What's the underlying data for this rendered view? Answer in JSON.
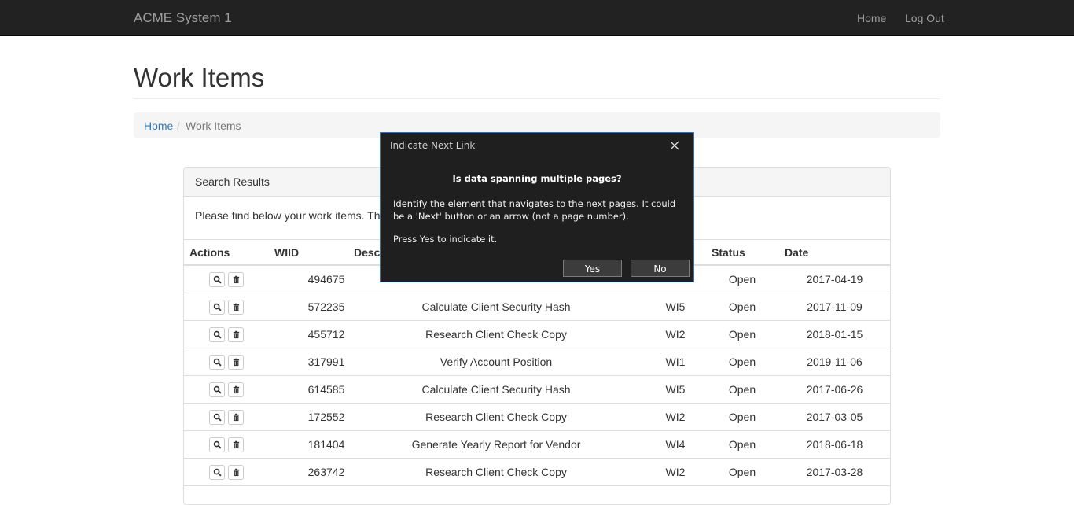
{
  "navbar": {
    "brand": "ACME System 1",
    "links": [
      "Home",
      "Log Out"
    ]
  },
  "page": {
    "title": "Work Items"
  },
  "breadcrumb": {
    "home": "Home",
    "separator": "/",
    "current": "Work Items"
  },
  "panel": {
    "title": "Search Results",
    "text": "Please find below your work items. They n",
    "columns": [
      "Actions",
      "WIID",
      "Descr",
      "Status",
      "Date"
    ],
    "rows": [
      {
        "wiid": "494675",
        "description": "",
        "type": "",
        "status": "Open",
        "date": "2017-04-19"
      },
      {
        "wiid": "572235",
        "description": "Calculate Client Security Hash",
        "type": "WI5",
        "status": "Open",
        "date": "2017-11-09"
      },
      {
        "wiid": "455712",
        "description": "Research Client Check Copy",
        "type": "WI2",
        "status": "Open",
        "date": "2018-01-15"
      },
      {
        "wiid": "317991",
        "description": "Verify Account Position",
        "type": "WI1",
        "status": "Open",
        "date": "2019-11-06"
      },
      {
        "wiid": "614585",
        "description": "Calculate Client Security Hash",
        "type": "WI5",
        "status": "Open",
        "date": "2017-06-26"
      },
      {
        "wiid": "172552",
        "description": "Research Client Check Copy",
        "type": "WI2",
        "status": "Open",
        "date": "2017-03-05"
      },
      {
        "wiid": "181404",
        "description": "Generate Yearly Report for Vendor",
        "type": "WI4",
        "status": "Open",
        "date": "2018-06-18"
      },
      {
        "wiid": "263742",
        "description": "Research Client Check Copy",
        "type": "WI2",
        "status": "Open",
        "date": "2017-03-28"
      }
    ]
  },
  "dialog": {
    "title": "Indicate Next Link",
    "heading": "Is data spanning multiple pages?",
    "body": "Identify the element that navigates to the next pages. It could be a 'Next' button or an arrow (not a page number).",
    "body2": "Press Yes to indicate it.",
    "yes": "Yes",
    "no": "No"
  },
  "icons": {
    "view": "search-icon",
    "delete": "trash-icon",
    "close": "close-icon"
  },
  "colors": {
    "navbar": "#222222",
    "link": "#337ab7",
    "dialog_bg": "#1f1f1f",
    "dialog_border": "#3a6ea5"
  }
}
